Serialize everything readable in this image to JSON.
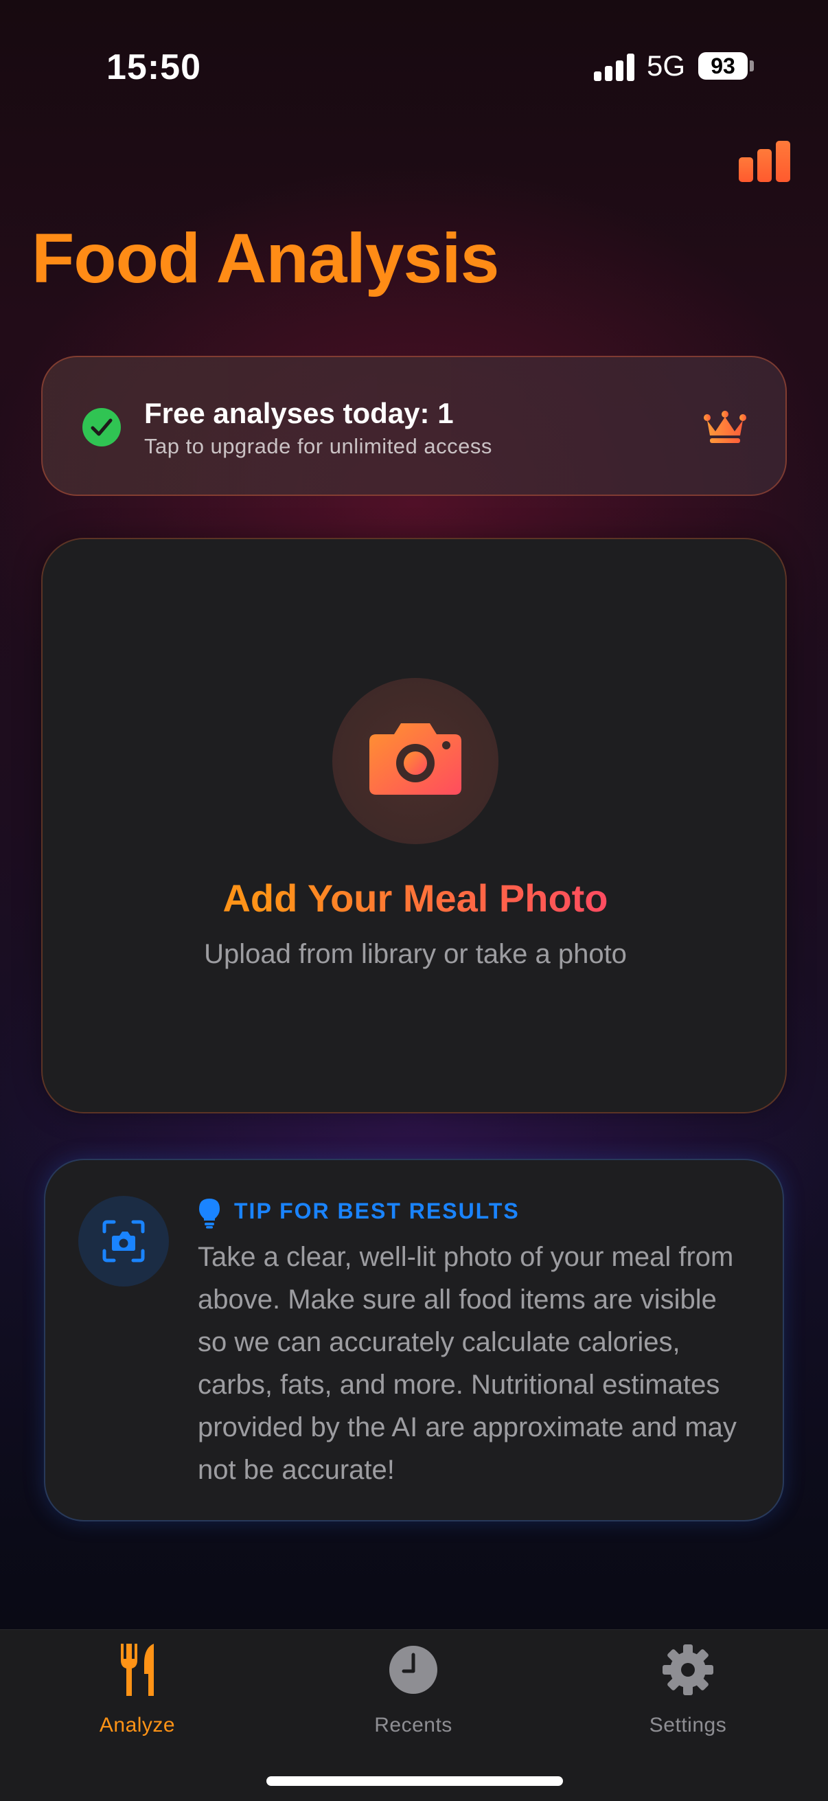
{
  "status_bar": {
    "time": "15:50",
    "network": "5G",
    "battery": "93"
  },
  "header": {
    "title": "Food Analysis",
    "stats_icon": "bar-chart-icon"
  },
  "free_card": {
    "title": "Free analyses today: 1",
    "subtitle": "Tap to upgrade for unlimited access",
    "status_icon": "checkmark-circle-icon",
    "upgrade_icon": "crown-icon"
  },
  "photo_card": {
    "icon": "camera-icon",
    "title": "Add Your Meal Photo",
    "subtitle": "Upload from library or take a photo"
  },
  "tip_card": {
    "icon": "camera-viewfinder-icon",
    "label_icon": "lightbulb-icon",
    "label": "TIP FOR BEST RESULTS",
    "text": "Take a clear, well-lit photo of your meal from above. Make sure all food items are visible so we can accurately calculate calories, carbs, fats, and more. Nutritional estimates provided by the AI are approximate and may not be accurate!"
  },
  "tab_bar": {
    "tabs": [
      {
        "label": "Analyze",
        "icon": "fork-knife-icon",
        "active": true
      },
      {
        "label": "Recents",
        "icon": "clock-icon",
        "active": false
      },
      {
        "label": "Settings",
        "icon": "gear-icon",
        "active": false
      }
    ]
  },
  "colors": {
    "accent": "#ff8c16",
    "tip_blue": "#1a84ff",
    "success": "#30c453"
  }
}
